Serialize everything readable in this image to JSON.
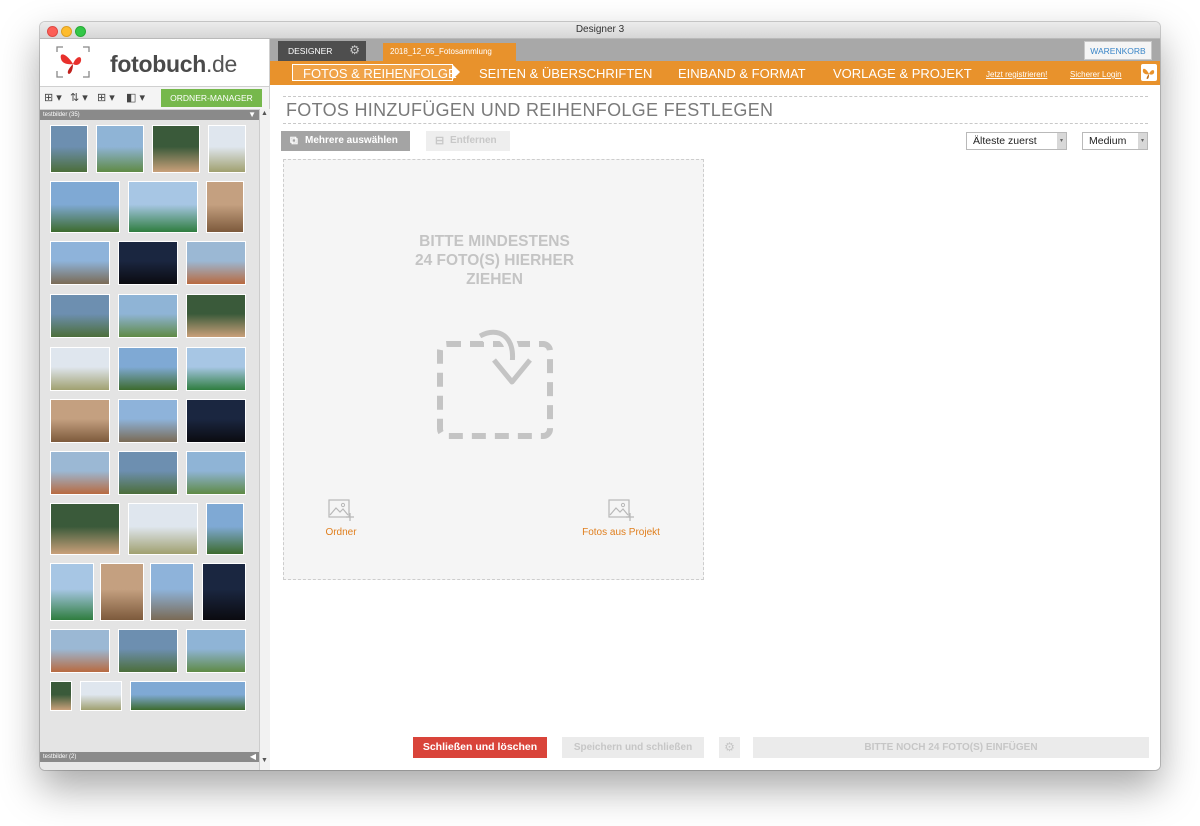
{
  "window": {
    "title": "Designer 3"
  },
  "sidebar": {
    "logo_text_main": "fotobuch",
    "logo_text_tld": ".de",
    "toolbar": {
      "icons": [
        "grid-view-icon",
        "sort-icon",
        "layout-icon",
        "frame-icon"
      ],
      "ordner_manager_label": "ORDNER-MANAGER"
    },
    "folders": [
      {
        "label": "testbilder (35)"
      },
      {
        "label": "testbilder (2)"
      }
    ]
  },
  "topbar": {
    "designer_tab": "DESIGNER",
    "project_tab": "2018_12_05_Fotosammlung",
    "cart_label": "WARENKORB"
  },
  "nav": {
    "steps": [
      {
        "label": "FOTOS & REIHENFOLGE",
        "active": true
      },
      {
        "label": "SEITEN & ÜBERSCHRIFTEN",
        "active": false
      },
      {
        "label": "EINBAND & FORMAT",
        "active": false
      },
      {
        "label": "VORLAGE & PROJEKT",
        "active": false
      }
    ],
    "register_link": "Jetzt registrieren!",
    "login_link": "Sicherer Login"
  },
  "main": {
    "heading": "FOTOS HINZUFÜGEN UND REIHENFOLGE FESTLEGEN",
    "select_multiple_label": "Mehrere auswählen",
    "remove_label": "Entfernen",
    "sort_select": "Älteste zuerst",
    "size_select": "Medium",
    "dropzone": {
      "line1": "BITTE MINDESTENS",
      "line2": "24 FOTO(S) HIERHER",
      "line3": "ZIEHEN",
      "folder_link": "Ordner",
      "project_link": "Fotos aus Projekt"
    }
  },
  "footer": {
    "close_delete": "Schließen und löschen",
    "save_close": "Speichern und schließen",
    "insert_status": "BITTE NOCH 24 FOTO(S) EINFÜGEN"
  },
  "colors": {
    "brand_orange": "#e8922c",
    "accent_green": "#76b84c",
    "danger_red": "#d9443a",
    "link_blue": "#3a86c8"
  }
}
